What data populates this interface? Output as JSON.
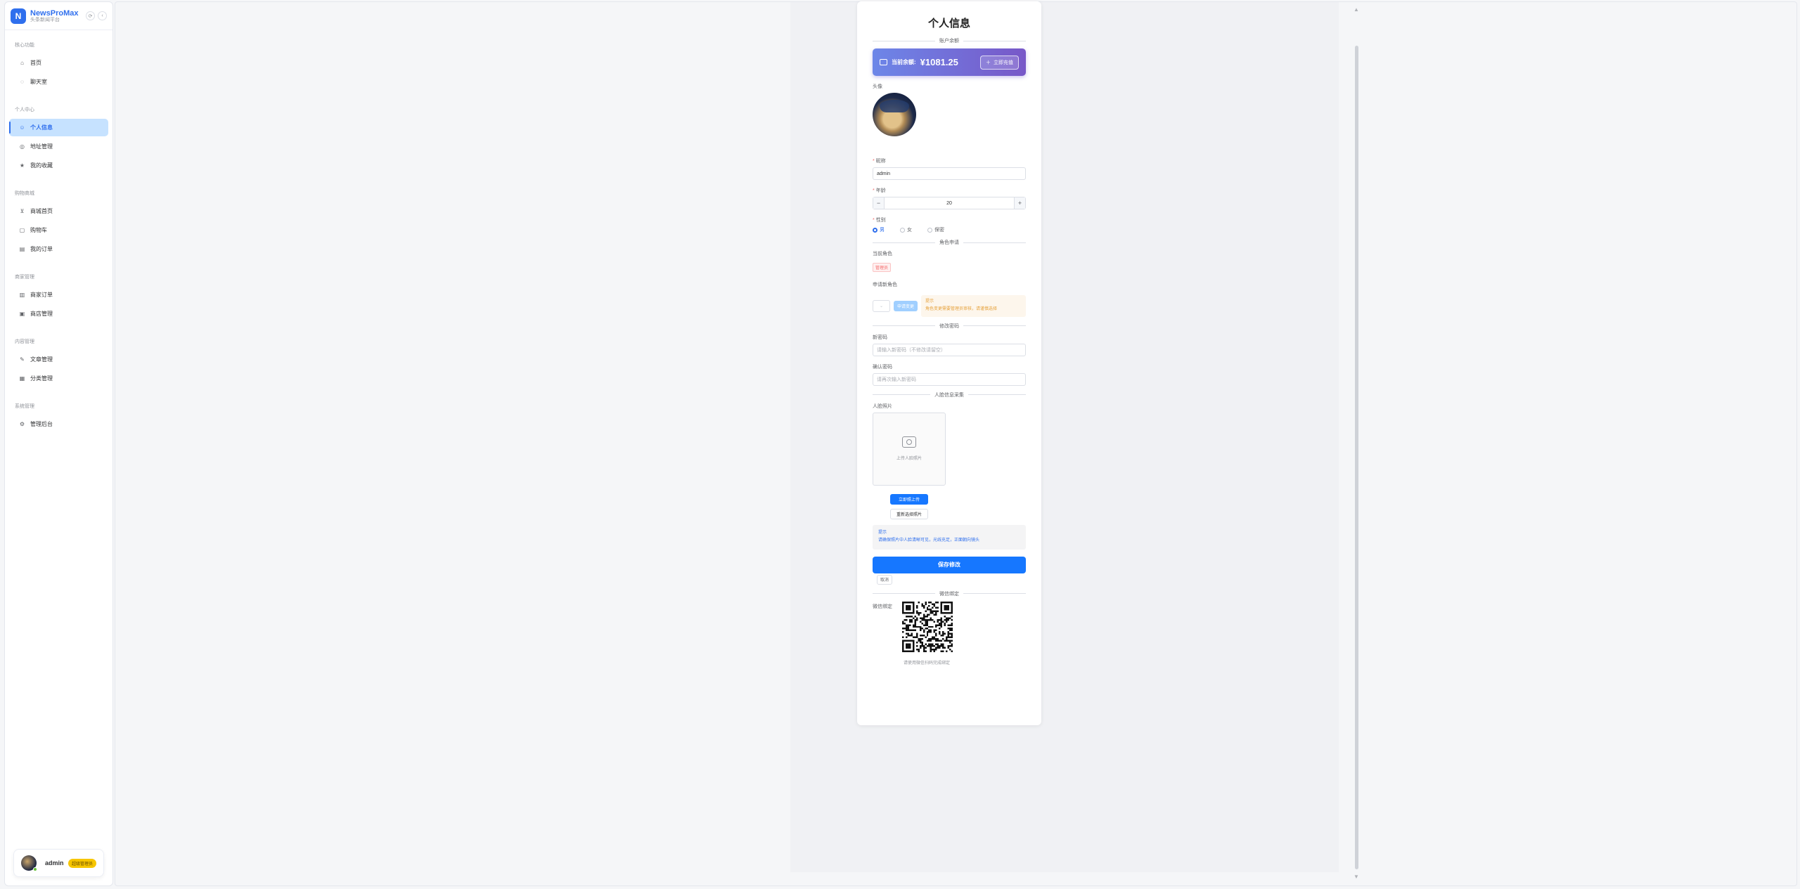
{
  "brand": {
    "name": "NewsProMax",
    "sub": "头条新闻平台",
    "logo_letter": "N"
  },
  "sidebar": {
    "groups": [
      {
        "title": "核心功能",
        "items": [
          {
            "label": "首页",
            "icon": "home-icon"
          },
          {
            "label": "聊天室",
            "icon": "chat-icon"
          }
        ]
      },
      {
        "title": "个人中心",
        "items": [
          {
            "label": "个人信息",
            "icon": "user-icon",
            "active": true
          },
          {
            "label": "地址管理",
            "icon": "location-icon"
          },
          {
            "label": "我的收藏",
            "icon": "star-icon"
          }
        ]
      },
      {
        "title": "购物商城",
        "items": [
          {
            "label": "商城首页",
            "icon": "cart-icon"
          },
          {
            "label": "购物车",
            "icon": "bag-icon"
          },
          {
            "label": "我的订单",
            "icon": "order-icon"
          }
        ]
      },
      {
        "title": "商家管理",
        "items": [
          {
            "label": "商家订单",
            "icon": "doc-icon"
          },
          {
            "label": "商店管理",
            "icon": "shop-icon"
          }
        ]
      },
      {
        "title": "内容管理",
        "items": [
          {
            "label": "文章管理",
            "icon": "edit-icon"
          },
          {
            "label": "分类管理",
            "icon": "grid-icon"
          }
        ]
      },
      {
        "title": "系统管理",
        "items": [
          {
            "label": "管理后台",
            "icon": "gear-icon"
          }
        ]
      }
    ]
  },
  "user": {
    "name": "admin",
    "badge": "超级管理员"
  },
  "profile": {
    "title": "个人信息",
    "sections": {
      "account": "账户余额",
      "role": "角色申请",
      "password": "修改密码",
      "face": "人脸信息采集",
      "wechat": "微信绑定"
    },
    "balance": {
      "label": "当前余额:",
      "value": "¥1081.25",
      "recharge": "立即充值"
    },
    "avatar_label": "头像",
    "nickname": {
      "label": "昵称",
      "value": "admin"
    },
    "age": {
      "label": "年龄",
      "value": "20"
    },
    "gender": {
      "label": "性别",
      "options": [
        "男",
        "女",
        "保密"
      ],
      "selected": "男"
    },
    "role": {
      "current_label": "当前角色",
      "current_value": "管理员",
      "apply_label": "申请新角色",
      "select_placeholder": "",
      "apply_button": "申请变更",
      "warn_title": "提示",
      "warn_text": "角色变更需要管理员审核，请谨慎选择"
    },
    "password": {
      "new_label": "新密码",
      "new_placeholder": "请输入新密码（不修改请留空）",
      "confirm_label": "确认密码",
      "confirm_placeholder": "请再次输入新密码"
    },
    "face": {
      "label": "人脸照片",
      "upload_text": "上传人脸照片",
      "upload_now": "立即照上传",
      "reselect": "重新选择照片",
      "info_title": "提示",
      "info_text": "请确保照片中人脸清晰可见，光线充足，正面朝向镜头"
    },
    "save": "保存修改",
    "cancel": "取消",
    "wechat": {
      "label": "微信绑定",
      "caption": "请使用微信扫码完成绑定"
    }
  },
  "colors": {
    "primary": "#1677ff",
    "active_bg": "#c6e2ff",
    "balance_from": "#6d86e8",
    "balance_to": "#7858c8"
  }
}
